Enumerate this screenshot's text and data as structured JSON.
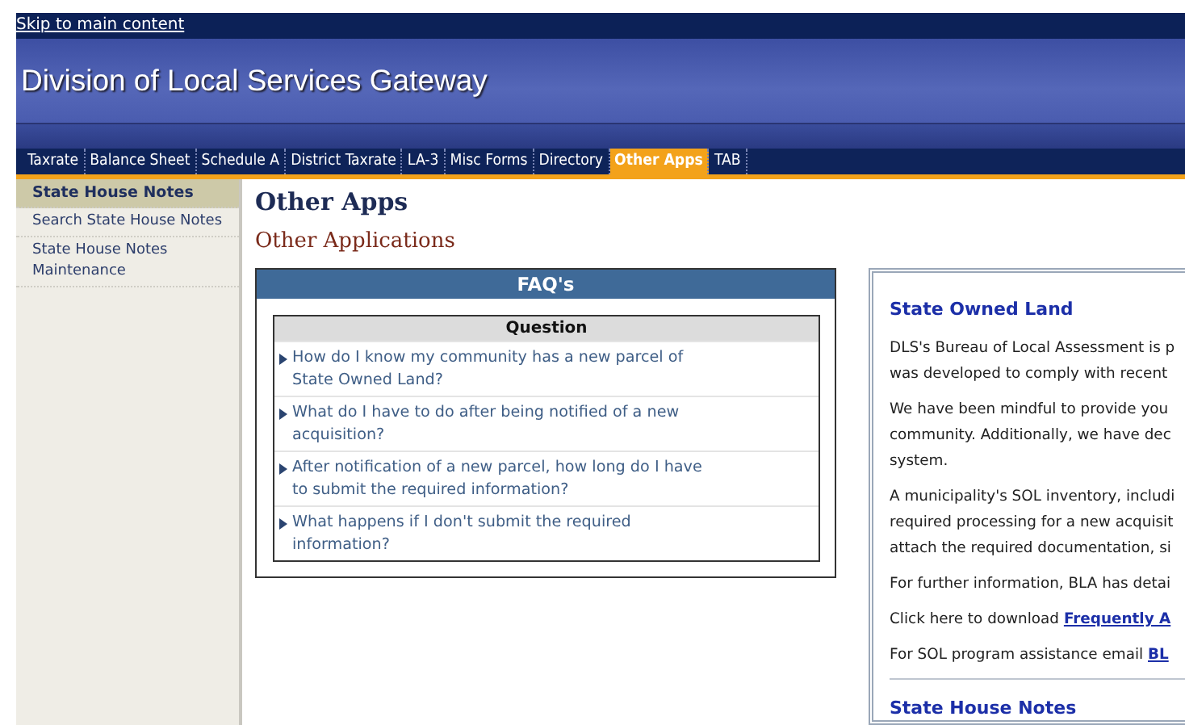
{
  "skip_link": "Skip to main content",
  "site_title": "Division of Local Services Gateway",
  "tabs": [
    {
      "label": "Taxrate",
      "selected": false
    },
    {
      "label": "Balance Sheet",
      "selected": false
    },
    {
      "label": "Schedule A",
      "selected": false
    },
    {
      "label": "District Taxrate",
      "selected": false
    },
    {
      "label": "LA-3",
      "selected": false
    },
    {
      "label": "Misc Forms",
      "selected": false
    },
    {
      "label": "Directory",
      "selected": false
    },
    {
      "label": "Other Apps",
      "selected": true
    },
    {
      "label": "TAB",
      "selected": false
    }
  ],
  "sidebar": {
    "items": [
      {
        "label": "State House Notes",
        "selected": true
      },
      {
        "label": "Search State House Notes",
        "selected": false
      },
      {
        "label": "State House Notes Maintenance",
        "selected": false
      }
    ]
  },
  "page_title": "Other Apps",
  "subtitle": "Other Applications",
  "faq": {
    "title": "FAQ's",
    "column": "Question",
    "questions": [
      "How do I know my community has a new parcel of State Owned Land?",
      "What do I have to do after being notified of a new acquisition?",
      "After notification of a new parcel, how long do I have to submit the required information?",
      "What happens if I don't submit the required information?"
    ]
  },
  "info_panel": {
    "heading": "State Owned Land",
    "paragraphs": [
      {
        "lines": [
          "DLS's Bureau of Local Assessment is p",
          "was developed to comply with recent"
        ]
      },
      {
        "lines": [
          "We have been mindful to provide you",
          "community. Additionally, we have dec",
          "system."
        ]
      },
      {
        "lines": [
          "A municipality's SOL inventory, includi",
          "required processing for a new acquisit",
          "attach the required documentation, si"
        ]
      },
      {
        "lines": [
          "For further information, BLA has detai"
        ]
      },
      {
        "lines": [
          "Click here to download "
        ],
        "link": "Frequently A"
      },
      {
        "lines": [
          "For SOL program assistance email "
        ],
        "link": "BL"
      }
    ],
    "heading_2": "State House Notes"
  }
}
